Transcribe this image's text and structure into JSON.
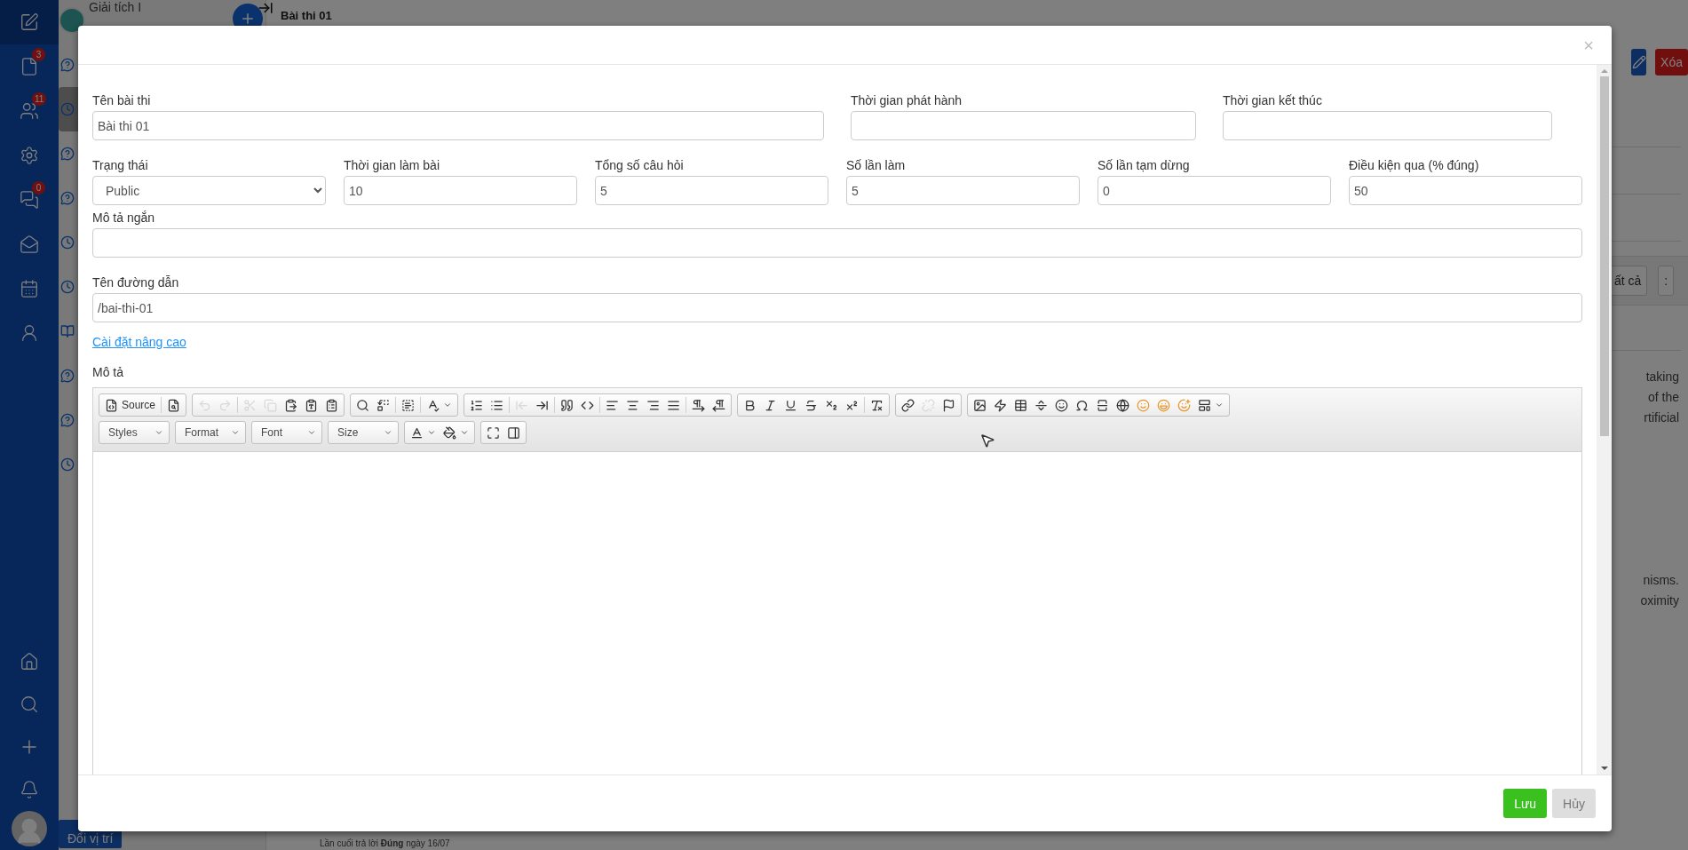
{
  "background": {
    "course_title": "Giải tích I",
    "page_title": "Bài thi 01",
    "nav": [
      {
        "selected": true
      },
      {
        "selected": false,
        "badge": "3"
      },
      {
        "selected": false,
        "badge": "11"
      },
      {
        "selected": false
      },
      {
        "selected": false,
        "badge": "0"
      },
      {
        "selected": false
      },
      {
        "selected": false
      },
      {
        "selected": false
      }
    ],
    "list": [
      {
        "kind": "question",
        "selected": false
      },
      {
        "kind": "clock",
        "selected": true
      },
      {
        "kind": "question",
        "selected": false
      },
      {
        "kind": "question",
        "selected": false
      },
      {
        "kind": "clock",
        "selected": false
      },
      {
        "kind": "clock",
        "selected": false
      },
      {
        "kind": "book",
        "selected": false
      },
      {
        "kind": "question",
        "selected": false
      },
      {
        "kind": "question",
        "selected": false
      },
      {
        "kind": "clock",
        "selected": false
      }
    ],
    "reposition_button": "Đổi vị trí",
    "delete_button": "Xóa",
    "filter_button": "ất cả",
    "more_button": ":",
    "text_block_1": [
      "taking",
      "of the",
      "rtificial"
    ],
    "text_block_2": [
      "nisms.",
      "oximity"
    ],
    "footer_note": "Lần cuối trả lời **Đúng** ngày 16/07"
  },
  "modal": {
    "close": "×",
    "row_1": [
      {
        "label": "Tên bài thi",
        "value": "Bài thi 01",
        "kind": "text"
      },
      {
        "label": "Thời gian phát hành",
        "kind": "text"
      },
      {
        "label": "Thời gian kết thúc",
        "kind": "text"
      }
    ],
    "row_2": [
      {
        "label": "Trạng thái",
        "value": "Public",
        "kind": "select"
      },
      {
        "label": "Thời gian làm bài",
        "value": "10",
        "kind": "text"
      },
      {
        "label": "Tổng số câu hỏi",
        "value": "5",
        "kind": "text"
      },
      {
        "label": "Số lần làm",
        "value": "5",
        "kind": "text"
      },
      {
        "label": "Số lần tạm dừng",
        "value": "0",
        "kind": "text"
      },
      {
        "label": "Điều kiện qua (% đúng)",
        "value": "50",
        "kind": "text"
      }
    ],
    "short_description": {
      "label": "Mô tả ngắn"
    },
    "path": {
      "label": "Tên đường dẫn",
      "value": "/bai-thi-01"
    },
    "advanced_link": "Cài đặt nâng cao",
    "editor": {
      "label": "Mô tả",
      "toolbar": [
        [
          {
            "items": [
              {
                "kind": "button",
                "label": "Source"
              },
              {
                "kind": "separator"
              },
              {
                "kind": "icon",
                "disabled": false
              }
            ]
          },
          {
            "items": [
              {
                "kind": "icon",
                "disabled": true
              },
              {
                "kind": "icon",
                "disabled": true
              },
              {
                "kind": "separator"
              },
              {
                "kind": "icon",
                "disabled": true
              },
              {
                "kind": "icon",
                "disabled": true
              },
              {
                "kind": "icon",
                "disabled": false
              },
              {
                "kind": "icon",
                "disabled": false
              },
              {
                "kind": "icon",
                "disabled": false
              }
            ]
          },
          {
            "items": [
              {
                "kind": "icon",
                "disabled": false
              },
              {
                "kind": "icon",
                "disabled": false
              },
              {
                "kind": "separator"
              },
              {
                "kind": "icon",
                "disabled": false
              },
              {
                "kind": "separator"
              },
              {
                "kind": "menu",
                "disabled": false
              }
            ]
          },
          {
            "items": [
              {
                "kind": "icon",
                "disabled": false
              },
              {
                "kind": "icon",
                "disabled": false
              },
              {
                "kind": "separator"
              },
              {
                "kind": "icon",
                "disabled": true
              },
              {
                "kind": "icon",
                "disabled": false
              },
              {
                "kind": "separator"
              },
              {
                "kind": "icon",
                "disabled": false
              },
              {
                "kind": "icon",
                "disabled": false
              },
              {
                "kind": "separator"
              },
              {
                "kind": "icon",
                "disabled": false
              },
              {
                "kind": "icon",
                "disabled": false
              },
              {
                "kind": "icon",
                "disabled": false
              },
              {
                "kind": "icon",
                "disabled": false
              },
              {
                "kind": "separator"
              },
              {
                "kind": "icon",
                "disabled": false
              },
              {
                "kind": "icon",
                "disabled": false
              }
            ]
          },
          {
            "items": [
              {
                "kind": "icon",
                "disabled": false
              },
              {
                "kind": "icon",
                "disabled": false
              },
              {
                "kind": "icon",
                "disabled": false
              },
              {
                "kind": "icon",
                "disabled": false
              },
              {
                "kind": "icon",
                "disabled": false
              },
              {
                "kind": "icon",
                "disabled": false
              },
              {
                "kind": "separator"
              },
              {
                "kind": "icon",
                "disabled": false
              }
            ]
          },
          {
            "items": [
              {
                "kind": "icon",
                "disabled": false
              },
              {
                "kind": "icon",
                "disabled": true
              },
              {
                "kind": "icon",
                "disabled": false
              }
            ]
          },
          {
            "items": [
              {
                "kind": "icon",
                "disabled": false
              },
              {
                "kind": "icon",
                "disabled": false
              },
              {
                "kind": "icon",
                "disabled": false
              },
              {
                "kind": "icon",
                "disabled": false
              },
              {
                "kind": "icon",
                "disabled": false
              },
              {
                "kind": "icon",
                "disabled": false
              },
              {
                "kind": "icon",
                "disabled": false
              },
              {
                "kind": "icon",
                "disabled": false
              },
              {
                "kind": "icon",
                "disabled": false
              },
              {
                "kind": "icon",
                "disabled": false
              },
              {
                "kind": "icon",
                "disabled": false
              },
              {
                "kind": "menu",
                "disabled": false
              }
            ]
          }
        ],
        [
          {
            "items": [
              {
                "kind": "combo",
                "label": "Styles"
              }
            ]
          },
          {
            "items": [
              {
                "kind": "combo",
                "label": "Format"
              }
            ]
          },
          {
            "items": [
              {
                "kind": "combo",
                "label": "Font"
              }
            ]
          },
          {
            "items": [
              {
                "kind": "combo",
                "label": "Size"
              }
            ]
          },
          {
            "items": [
              {
                "kind": "menu",
                "disabled": false
              },
              {
                "kind": "menu",
                "disabled": false
              }
            ]
          },
          {
            "items": [
              {
                "kind": "icon",
                "disabled": false
              },
              {
                "kind": "icon",
                "disabled": false
              }
            ]
          }
        ]
      ]
    },
    "buttons": [
      {
        "label": "Lưu",
        "kind": "primary"
      },
      {
        "label": "Hủy",
        "kind": "secondary"
      }
    ]
  }
}
